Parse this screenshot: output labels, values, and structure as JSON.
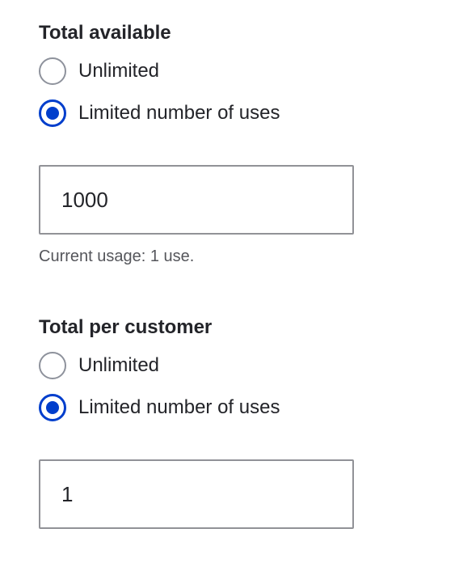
{
  "total_available": {
    "legend": "Total available",
    "options": [
      {
        "label": "Unlimited",
        "checked": false
      },
      {
        "label": "Limited number of uses",
        "checked": true
      }
    ],
    "input_value": "1000",
    "description": "Current usage: 1 use."
  },
  "total_per_customer": {
    "legend": "Total per customer",
    "options": [
      {
        "label": "Unlimited",
        "checked": false
      },
      {
        "label": "Limited number of uses",
        "checked": true
      }
    ],
    "input_value": "1"
  },
  "colors": {
    "accent": "#003ecc",
    "text": "#232429",
    "muted_text": "#55565b",
    "border": "#919297"
  }
}
